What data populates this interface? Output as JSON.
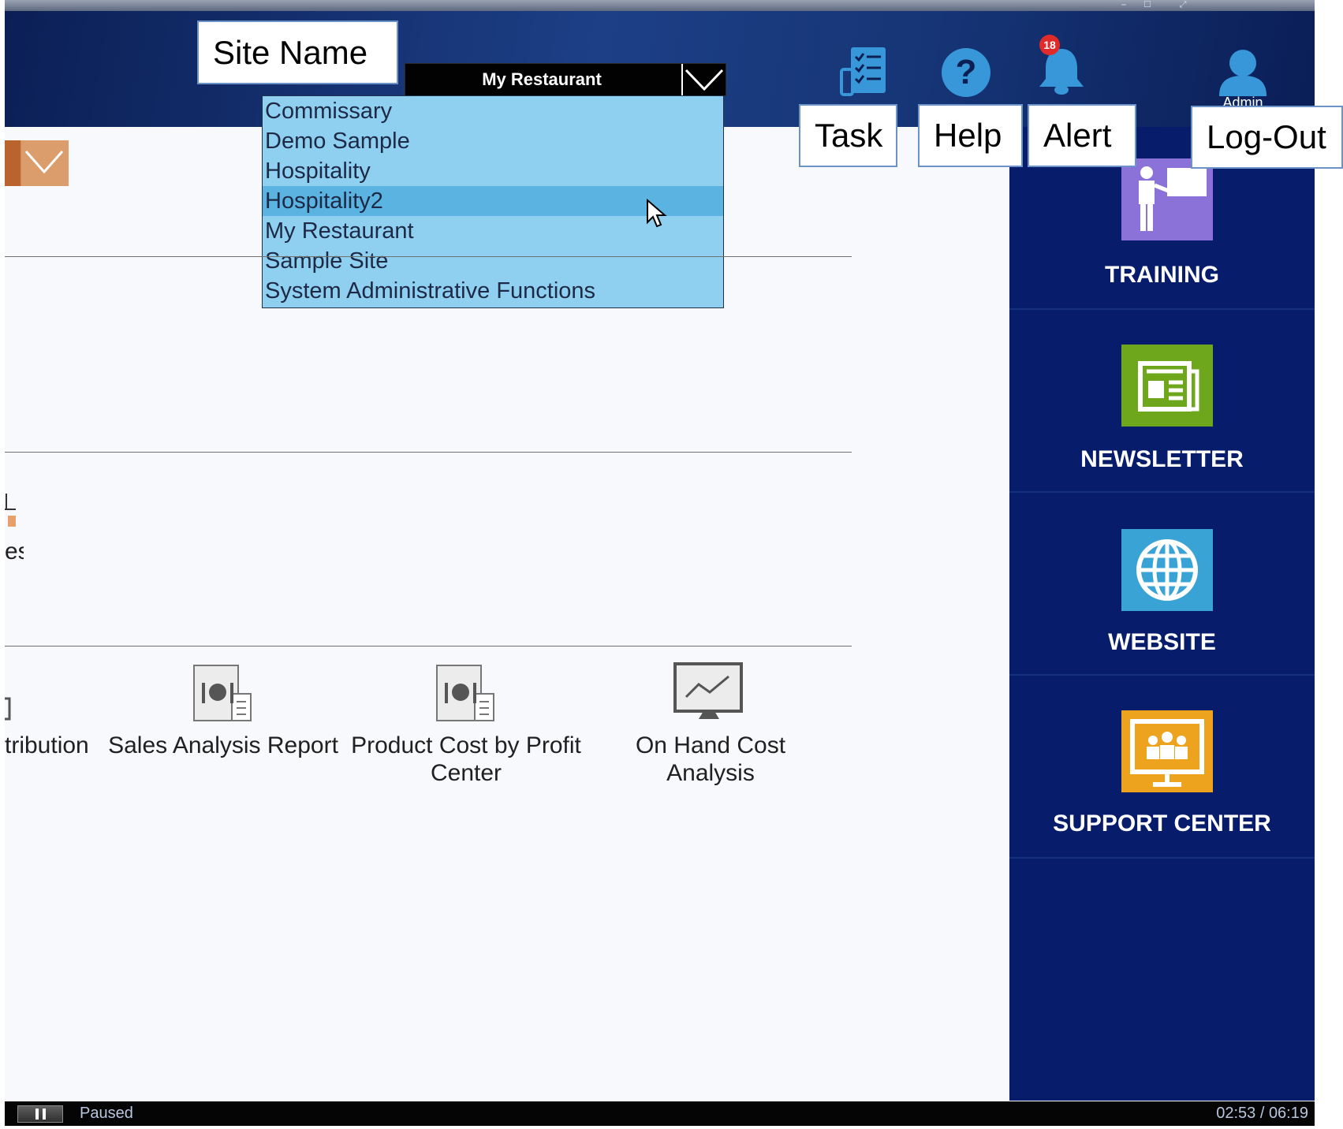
{
  "header": {
    "site_select_value": "My Restaurant",
    "alert_badge_count": "18",
    "admin_label": "Admin"
  },
  "site_dropdown": {
    "options": [
      "Commissary",
      "Demo Sample",
      "Hospitality",
      "Hospitality2",
      "My Restaurant",
      "Sample Site",
      "System Administrative Functions"
    ],
    "highlighted": "Hospitality2"
  },
  "callouts": {
    "site_name": "Site Name",
    "task": "Task",
    "help": "Help",
    "alert": "Alert",
    "logout": "Log-Out"
  },
  "main": {
    "partial_label_fragment": "es",
    "reports": [
      {
        "label": "tribution"
      },
      {
        "label": "Sales Analysis Report"
      },
      {
        "label": "Product Cost by Profit Center"
      },
      {
        "label": "On Hand Cost Analysis"
      }
    ]
  },
  "sidebar": {
    "items": [
      {
        "label": "TRAINING",
        "icon": "training-icon",
        "color": "#8b72d8"
      },
      {
        "label": "NEWSLETTER",
        "icon": "newsletter-icon",
        "color": "#6ea71c"
      },
      {
        "label": "WEBSITE",
        "icon": "globe-icon",
        "color": "#3aa3d6"
      },
      {
        "label": "SUPPORT CENTER",
        "icon": "support-monitor-icon",
        "color": "#eda31d"
      }
    ]
  },
  "player": {
    "status": "Paused",
    "time": "02:53 / 06:19"
  },
  "colors": {
    "header_dark": "#0b1f55",
    "sidebar_bg": "#071c6a",
    "dropdown_bg": "#8fd0f1",
    "dropdown_selected": "#5bb3e2",
    "alert_badge": "#e12a2a",
    "icon_blue": "#3797d8"
  }
}
